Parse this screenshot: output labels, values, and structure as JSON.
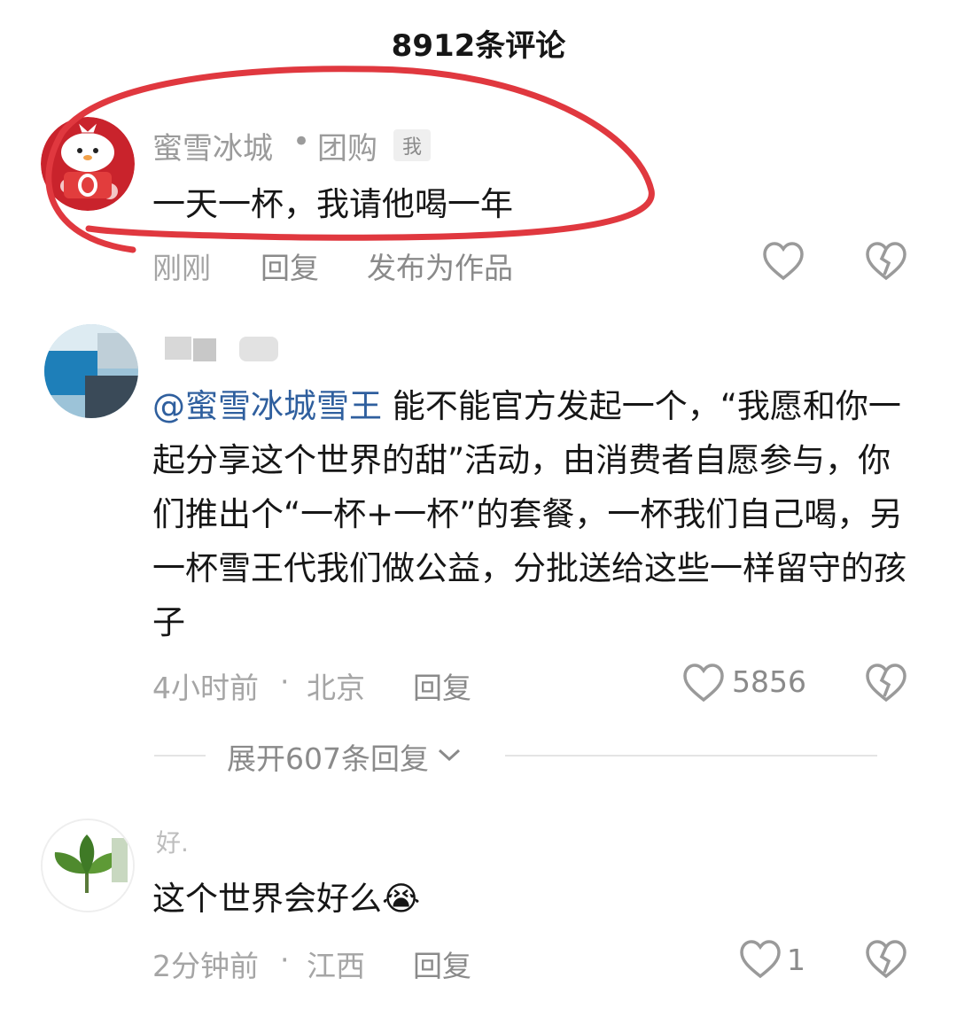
{
  "header": {
    "title": "8912条评论"
  },
  "comments": [
    {
      "username": "蜜雪冰城",
      "badge_separator": "•",
      "badge": "团购",
      "me_tag": "我",
      "text": "一天一杯，我请他喝一年",
      "time": "刚刚",
      "reply_label": "回复",
      "extra_action": "发布为作品"
    },
    {
      "mention": "@蜜雪冰城雪王",
      "text": " 能不能官方发起一个，“我愿和你一起分享这个世界的甜”活动，由消费者自愿参与，你们推出个“一杯+一杯”的套餐，一杯我们自己喝，另一杯雪王代我们做公益，分批送给这些一样留守的孩子",
      "time": "4小时前",
      "location_sep": "·",
      "location": "北京",
      "reply_label": "回复",
      "likes": "5856",
      "expand_label": "展开607条回复"
    },
    {
      "username_partial": "好.",
      "text": "这个世界会好么",
      "emoji": "😭",
      "time": "2分钟前",
      "location_sep": "·",
      "location": "江西",
      "reply_label": "回复",
      "likes": "1"
    }
  ],
  "colors": {
    "highlight_circle": "#e0383f",
    "mention": "#2f5f9e",
    "muted": "#a5a5a5"
  }
}
